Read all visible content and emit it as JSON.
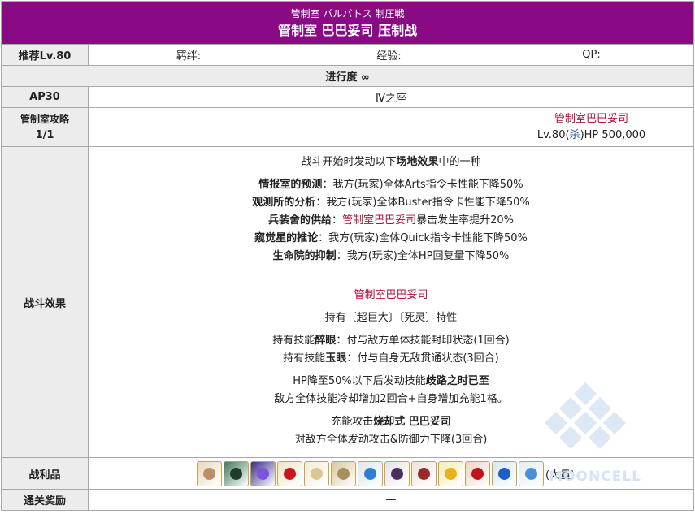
{
  "header": {
    "title_jp": "管制室 バルバトス 制圧戦",
    "title_cn": "管制室 巴巴妥司 压制战"
  },
  "rec_level": "推荐Lv.80",
  "bond_label": "羁绊:",
  "exp_label": "经验:",
  "qp_label": "QP:",
  "progress_label": "进行度 ∞",
  "ap_label": "AP30",
  "location": "Ⅳ之座",
  "stage": {
    "label": "管制室攻略",
    "count": "1/1",
    "enemy_name": "管制室巴巴妥司",
    "enemy_lv": "Lv.80(",
    "enemy_class": "杀",
    "enemy_hp": ")HP 500,000"
  },
  "battle_effects": {
    "label": "战斗效果",
    "intro_a": "战斗开始时发动以下",
    "intro_b": "场地效果",
    "intro_c": "中的一种",
    "fields": [
      {
        "name": "情报室的预测",
        "text": "：我方(玩家)全体Arts指令卡性能下降50%"
      },
      {
        "name": "观测所的分析",
        "text": "：我方(玩家)全体Buster指令卡性能下降50%"
      },
      {
        "name": "兵装舍的供给",
        "text_red": "管制室巴巴妥司",
        "text": "暴击发生率提升20%",
        "prefix": "："
      },
      {
        "name": "窥觉星的推论",
        "text": "：我方(玩家)全体Quick指令卡性能下降50%"
      },
      {
        "name": "生命院的抑制",
        "text": "：我方(玩家)全体HP回复量下降50%"
      }
    ],
    "boss_name": "管制室巴巴妥司",
    "traits": "持有〔超巨大〕〔死灵〕特性",
    "skill1_a": "持有技能",
    "skill1_name": "醉眼",
    "skill1_b": "：付与敌方单体技能封印状态(1回合)",
    "skill2_a": "持有技能",
    "skill2_name": "玉眼",
    "skill2_b": "：付与自身无敌贯通状态(3回合)",
    "hp_a": "HP降至50%以下后发动技能",
    "hp_name": "歧路之时已至",
    "hp_b": "敌方全体技能冷却增加2回合+自身增加充能1格。",
    "np_a": "充能攻击",
    "np_name": "烧却式 巴巴妥司",
    "np_b": "对敌方全体发动攻击&防御力下降(3回合)"
  },
  "drops": {
    "label": "战利品",
    "items": [
      {
        "icon": "saint-quartz-card-icon",
        "c1": "#e8d9b8",
        "c2": "#b98f6a"
      },
      {
        "icon": "green-wing-icon",
        "c1": "#3f7a5a",
        "c2": "#1f3b2c"
      },
      {
        "icon": "purple-crystal-icon",
        "c1": "#3a2a88",
        "c2": "#7b55e0"
      },
      {
        "icon": "red-orb-icon",
        "c1": "#f2e3c8",
        "c2": "#c8161c"
      },
      {
        "icon": "scroll-icon",
        "c1": "#f4ecd6",
        "c2": "#d9c894"
      },
      {
        "icon": "shell-icon",
        "c1": "#d9c7a0",
        "c2": "#a98f5c"
      },
      {
        "icon": "blue-lantern-icon",
        "c1": "#dfe6ee",
        "c2": "#2f7fd0"
      },
      {
        "icon": "dark-crystal-icon",
        "c1": "#e7e2ec",
        "c2": "#4a2e5e"
      },
      {
        "icon": "bone-icon",
        "c1": "#f0e2da",
        "c2": "#9a2a2a"
      },
      {
        "icon": "gold-star-icon",
        "c1": "#f8ecb0",
        "c2": "#e8b21a"
      },
      {
        "icon": "red-gem-icon",
        "c1": "#f3d2c6",
        "c2": "#c0141c"
      },
      {
        "icon": "blue-gem-icon",
        "c1": "#d8e6f5",
        "c2": "#1b5fc4"
      },
      {
        "icon": "blue-shard-icon",
        "c1": "#e2ecf6",
        "c2": "#4a8fd8"
      }
    ],
    "suffix": "(大量)"
  },
  "clear_reward": {
    "label": "通关奖励",
    "value": "—"
  },
  "watermark_text": "MOONCELL"
}
